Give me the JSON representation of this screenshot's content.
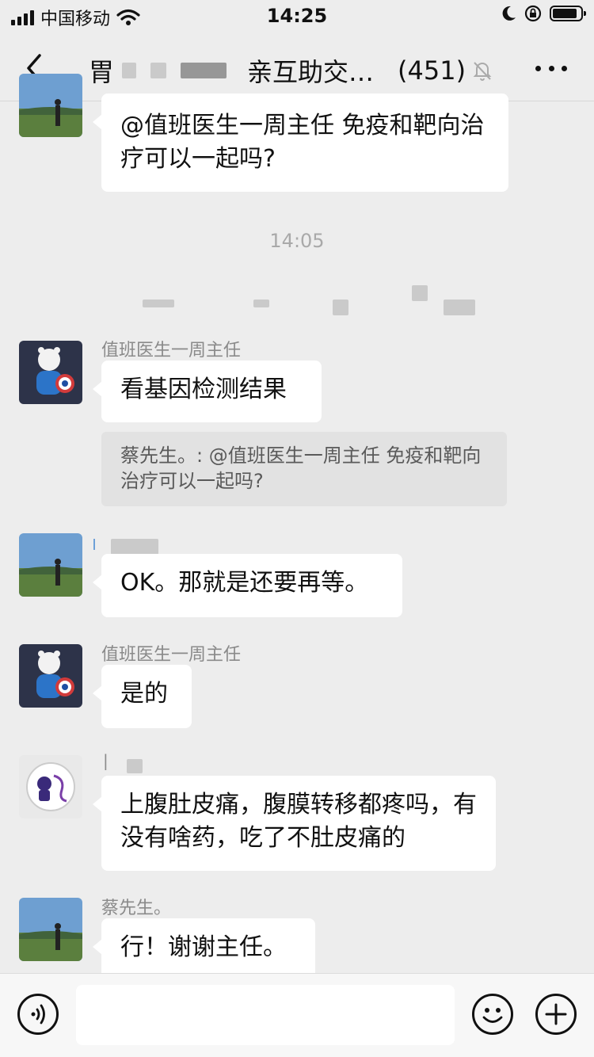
{
  "status_bar": {
    "carrier": "中国移动",
    "time": "14:25"
  },
  "nav": {
    "title_prefix": "胃",
    "title_main": "亲互助交…",
    "member_count": "(451)"
  },
  "chat": {
    "timestamp": "14:05",
    "messages": [
      {
        "sender": "",
        "text": "@值班医生一周主任 免疫和靶向治疗可以一起吗?"
      },
      {
        "sender": "值班医生一周主任",
        "text": "看基因检测结果",
        "quote": "蔡先生。: @值班医生一周主任 免疫和靶向治疗可以一起吗?"
      },
      {
        "sender": "",
        "text": "OK。那就是还要再等。"
      },
      {
        "sender": "值班医生一周主任",
        "text": "是的"
      },
      {
        "sender": "",
        "text": "上腹肚皮痛，腹膜转移都疼吗，有没有啥药，吃了不肚皮痛的"
      },
      {
        "sender": "蔡先生。",
        "text": "行！谢谢主任。"
      }
    ]
  },
  "input_bar": {
    "placeholder": ""
  },
  "icons": [
    "back-icon",
    "mute-bell-icon",
    "more-icon",
    "voice-icon",
    "emoji-icon",
    "plus-icon"
  ]
}
